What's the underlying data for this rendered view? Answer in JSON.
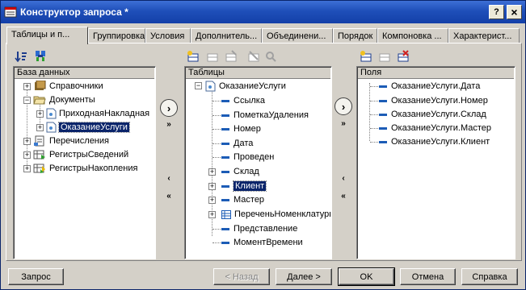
{
  "window": {
    "title": "Конструктор запроса *"
  },
  "titlebar_buttons": {
    "help": "?",
    "close": "×"
  },
  "tabs": [
    {
      "label": "Таблицы и п...",
      "active": true
    },
    {
      "label": "Группировка"
    },
    {
      "label": "Условия"
    },
    {
      "label": "Дополнитель..."
    },
    {
      "label": "Объединени..."
    },
    {
      "label": "Порядок"
    },
    {
      "label": "Компоновка ..."
    },
    {
      "label": "Характерист..."
    }
  ],
  "database_panel": {
    "header": "База данных",
    "items": [
      {
        "label": "Справочники"
      },
      {
        "label": "Документы"
      },
      {
        "label": "ПриходнаяНакладная"
      },
      {
        "label": "ОказаниеУслуги",
        "selected": true
      },
      {
        "label": "Перечисления"
      },
      {
        "label": "РегистрыСведений"
      },
      {
        "label": "РегистрыНакопления"
      }
    ]
  },
  "tables_panel": {
    "header": "Таблицы",
    "root": "ОказаниеУслуги",
    "items": [
      {
        "label": "Ссылка"
      },
      {
        "label": "ПометкаУдаления"
      },
      {
        "label": "Номер"
      },
      {
        "label": "Дата"
      },
      {
        "label": "Проведен"
      },
      {
        "label": "Склад"
      },
      {
        "label": "Клиент",
        "selected": true
      },
      {
        "label": "Мастер"
      },
      {
        "label": "ПереченьНоменклатуры"
      },
      {
        "label": "Представление"
      },
      {
        "label": "МоментВремени"
      }
    ]
  },
  "fields_panel": {
    "header": "Поля",
    "items": [
      {
        "label": "ОказаниеУслуги.Дата"
      },
      {
        "label": "ОказаниеУслуги.Номер"
      },
      {
        "label": "ОказаниеУслуги.Склад"
      },
      {
        "label": "ОказаниеУслуги.Мастер"
      },
      {
        "label": "ОказаниеУслуги.Клиент"
      }
    ]
  },
  "transfer": {
    "add_one": "›",
    "add_all": "»",
    "remove_one": "‹",
    "remove_all": "«"
  },
  "buttons": {
    "query": "Запрос",
    "back": "< Назад",
    "next": "Далее >",
    "ok": "OK",
    "cancel": "Отмена",
    "help": "Справка"
  },
  "colors": {
    "titlebar": "#1f4fb9",
    "selection": "#0a246a",
    "face": "#d4d0c8"
  }
}
